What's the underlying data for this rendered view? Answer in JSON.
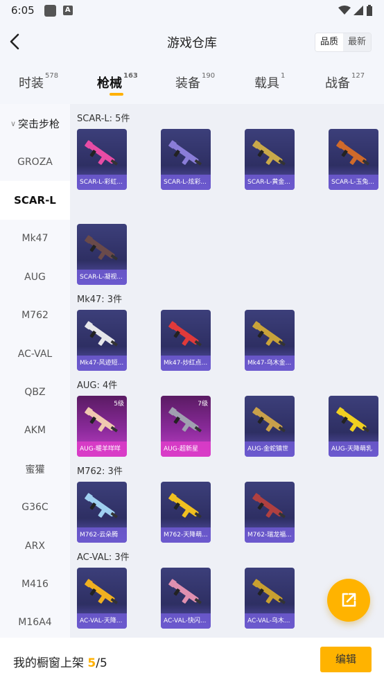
{
  "status_bar": {
    "time": "6:05"
  },
  "header": {
    "title": "游戏仓库",
    "sort_options": [
      "品质",
      "最新"
    ]
  },
  "tabs": [
    {
      "label": "时装",
      "count": "578"
    },
    {
      "label": "枪械",
      "count": "163",
      "active": true
    },
    {
      "label": "装备",
      "count": "190"
    },
    {
      "label": "载具",
      "count": "1"
    },
    {
      "label": "战备",
      "count": "127"
    }
  ],
  "sidebar": {
    "group": "突击步枪",
    "items": [
      "GROZA",
      "SCAR-L",
      "Mk47",
      "AUG",
      "M762",
      "AC-VAL",
      "QBZ",
      "AKM",
      "蜜獾",
      "G36C",
      "ARX",
      "M416",
      "M16A4"
    ],
    "active": "SCAR-L"
  },
  "sections": [
    {
      "label": "SCAR-L: 5件",
      "items": [
        {
          "name": "SCAR-L-彩虹...",
          "color": "#e84ca5"
        },
        {
          "name": "SCAR-L-炫彩...",
          "color": "#8a7dd8"
        },
        {
          "name": "SCAR-L-黄金...",
          "color": "#c9a94a"
        },
        {
          "name": "SCAR-L-玉兔...",
          "color": "#d06a2a"
        },
        {
          "name": "SCAR-L-凝视...",
          "color": "#6a4a4a"
        }
      ]
    },
    {
      "label": "Mk47: 3件",
      "items": [
        {
          "name": "Mk47-风迹短...",
          "color": "#e6e6ea"
        },
        {
          "name": "Mk47-炒红点...",
          "color": "#e03a3a"
        },
        {
          "name": "Mk47-乌木金...",
          "color": "#c9a33a"
        }
      ]
    },
    {
      "label": "AUG: 4件",
      "items": [
        {
          "name": "AUG-暖羊咩咩",
          "color": "#f0c9b0",
          "level": "5级",
          "pink": true
        },
        {
          "name": "AUG-超新星",
          "color": "#a0a0b0",
          "level": "7级",
          "pink": true
        },
        {
          "name": "AUG-金蛇镇世",
          "color": "#c9a04a"
        },
        {
          "name": "AUG-天降萌乳",
          "color": "#f0d020"
        }
      ]
    },
    {
      "label": "M762: 3件",
      "items": [
        {
          "name": "M762-云朵腾",
          "color": "#9fd0f0"
        },
        {
          "name": "M762-天降萌...",
          "color": "#f0c020"
        },
        {
          "name": "M762-瑞龙福...",
          "color": "#b04040"
        }
      ]
    },
    {
      "label": "AC-VAL: 3件",
      "items": [
        {
          "name": "AC-VAL-天降...",
          "color": "#f0b020"
        },
        {
          "name": "AC-VAL-快闪...",
          "color": "#e090b0"
        },
        {
          "name": "AC-VAL-乌木...",
          "color": "#c9a030"
        }
      ]
    }
  ],
  "bottom_bar": {
    "showcase_label": "我的橱窗上架",
    "showcase_count": "5",
    "showcase_total": "/5",
    "edit_label": "编辑"
  },
  "colors": {
    "accent": "#ffb300"
  }
}
